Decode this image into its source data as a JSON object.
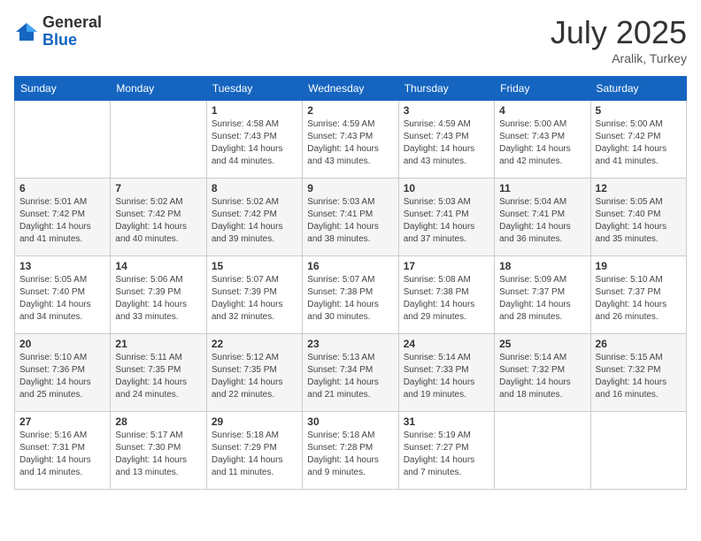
{
  "logo": {
    "general": "General",
    "blue": "Blue"
  },
  "title": {
    "month_year": "July 2025",
    "location": "Aralik, Turkey"
  },
  "headers": [
    "Sunday",
    "Monday",
    "Tuesday",
    "Wednesday",
    "Thursday",
    "Friday",
    "Saturday"
  ],
  "weeks": [
    [
      {
        "day": "",
        "detail": ""
      },
      {
        "day": "",
        "detail": ""
      },
      {
        "day": "1",
        "detail": "Sunrise: 4:58 AM\nSunset: 7:43 PM\nDaylight: 14 hours and 44 minutes."
      },
      {
        "day": "2",
        "detail": "Sunrise: 4:59 AM\nSunset: 7:43 PM\nDaylight: 14 hours and 43 minutes."
      },
      {
        "day": "3",
        "detail": "Sunrise: 4:59 AM\nSunset: 7:43 PM\nDaylight: 14 hours and 43 minutes."
      },
      {
        "day": "4",
        "detail": "Sunrise: 5:00 AM\nSunset: 7:43 PM\nDaylight: 14 hours and 42 minutes."
      },
      {
        "day": "5",
        "detail": "Sunrise: 5:00 AM\nSunset: 7:42 PM\nDaylight: 14 hours and 41 minutes."
      }
    ],
    [
      {
        "day": "6",
        "detail": "Sunrise: 5:01 AM\nSunset: 7:42 PM\nDaylight: 14 hours and 41 minutes."
      },
      {
        "day": "7",
        "detail": "Sunrise: 5:02 AM\nSunset: 7:42 PM\nDaylight: 14 hours and 40 minutes."
      },
      {
        "day": "8",
        "detail": "Sunrise: 5:02 AM\nSunset: 7:42 PM\nDaylight: 14 hours and 39 minutes."
      },
      {
        "day": "9",
        "detail": "Sunrise: 5:03 AM\nSunset: 7:41 PM\nDaylight: 14 hours and 38 minutes."
      },
      {
        "day": "10",
        "detail": "Sunrise: 5:03 AM\nSunset: 7:41 PM\nDaylight: 14 hours and 37 minutes."
      },
      {
        "day": "11",
        "detail": "Sunrise: 5:04 AM\nSunset: 7:41 PM\nDaylight: 14 hours and 36 minutes."
      },
      {
        "day": "12",
        "detail": "Sunrise: 5:05 AM\nSunset: 7:40 PM\nDaylight: 14 hours and 35 minutes."
      }
    ],
    [
      {
        "day": "13",
        "detail": "Sunrise: 5:05 AM\nSunset: 7:40 PM\nDaylight: 14 hours and 34 minutes."
      },
      {
        "day": "14",
        "detail": "Sunrise: 5:06 AM\nSunset: 7:39 PM\nDaylight: 14 hours and 33 minutes."
      },
      {
        "day": "15",
        "detail": "Sunrise: 5:07 AM\nSunset: 7:39 PM\nDaylight: 14 hours and 32 minutes."
      },
      {
        "day": "16",
        "detail": "Sunrise: 5:07 AM\nSunset: 7:38 PM\nDaylight: 14 hours and 30 minutes."
      },
      {
        "day": "17",
        "detail": "Sunrise: 5:08 AM\nSunset: 7:38 PM\nDaylight: 14 hours and 29 minutes."
      },
      {
        "day": "18",
        "detail": "Sunrise: 5:09 AM\nSunset: 7:37 PM\nDaylight: 14 hours and 28 minutes."
      },
      {
        "day": "19",
        "detail": "Sunrise: 5:10 AM\nSunset: 7:37 PM\nDaylight: 14 hours and 26 minutes."
      }
    ],
    [
      {
        "day": "20",
        "detail": "Sunrise: 5:10 AM\nSunset: 7:36 PM\nDaylight: 14 hours and 25 minutes."
      },
      {
        "day": "21",
        "detail": "Sunrise: 5:11 AM\nSunset: 7:35 PM\nDaylight: 14 hours and 24 minutes."
      },
      {
        "day": "22",
        "detail": "Sunrise: 5:12 AM\nSunset: 7:35 PM\nDaylight: 14 hours and 22 minutes."
      },
      {
        "day": "23",
        "detail": "Sunrise: 5:13 AM\nSunset: 7:34 PM\nDaylight: 14 hours and 21 minutes."
      },
      {
        "day": "24",
        "detail": "Sunrise: 5:14 AM\nSunset: 7:33 PM\nDaylight: 14 hours and 19 minutes."
      },
      {
        "day": "25",
        "detail": "Sunrise: 5:14 AM\nSunset: 7:32 PM\nDaylight: 14 hours and 18 minutes."
      },
      {
        "day": "26",
        "detail": "Sunrise: 5:15 AM\nSunset: 7:32 PM\nDaylight: 14 hours and 16 minutes."
      }
    ],
    [
      {
        "day": "27",
        "detail": "Sunrise: 5:16 AM\nSunset: 7:31 PM\nDaylight: 14 hours and 14 minutes."
      },
      {
        "day": "28",
        "detail": "Sunrise: 5:17 AM\nSunset: 7:30 PM\nDaylight: 14 hours and 13 minutes."
      },
      {
        "day": "29",
        "detail": "Sunrise: 5:18 AM\nSunset: 7:29 PM\nDaylight: 14 hours and 11 minutes."
      },
      {
        "day": "30",
        "detail": "Sunrise: 5:18 AM\nSunset: 7:28 PM\nDaylight: 14 hours and 9 minutes."
      },
      {
        "day": "31",
        "detail": "Sunrise: 5:19 AM\nSunset: 7:27 PM\nDaylight: 14 hours and 7 minutes."
      },
      {
        "day": "",
        "detail": ""
      },
      {
        "day": "",
        "detail": ""
      }
    ]
  ]
}
